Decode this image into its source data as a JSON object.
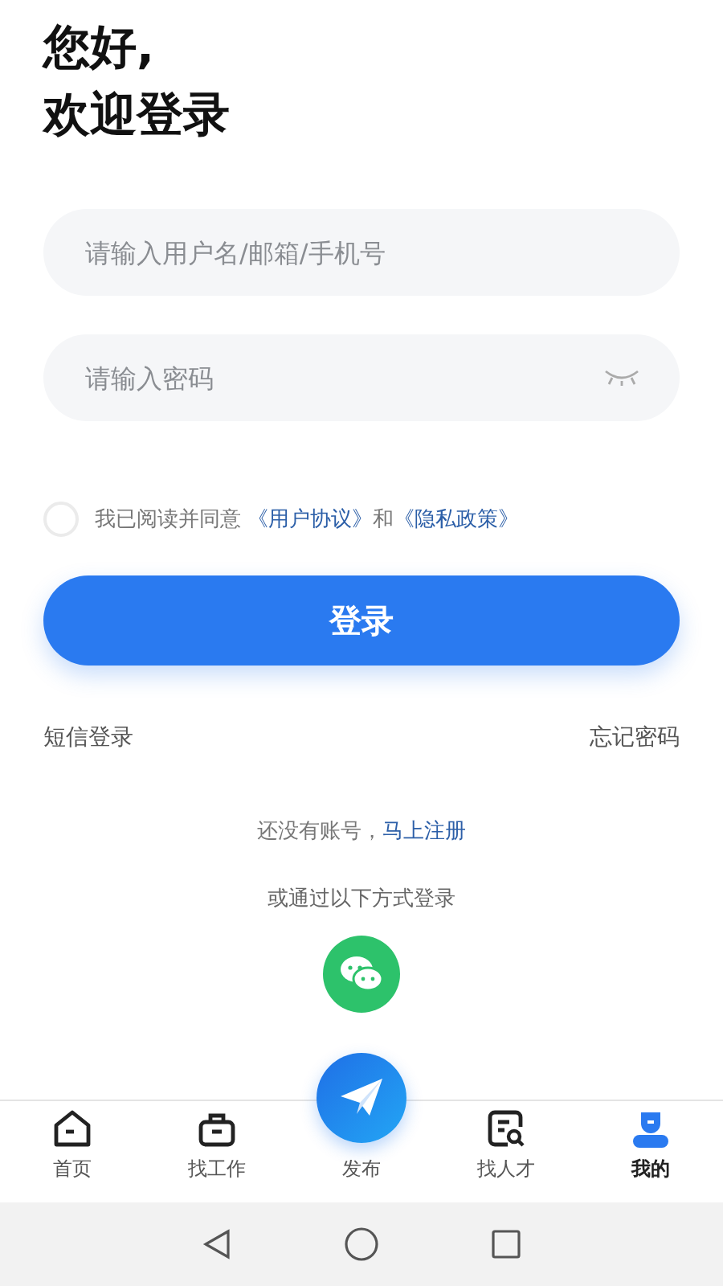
{
  "greeting": [
    "您好,",
    "欢迎登录"
  ],
  "fields": [
    {
      "placeholder": "请输入用户名/邮箱/手机号",
      "kind": "text"
    },
    {
      "placeholder": "请输入密码",
      "kind": "password"
    }
  ],
  "agreement": {
    "checked": false,
    "text": "我已阅读并同意",
    "link_1": "《用户协议》",
    "joiner": "和",
    "link_2": "《隐私政策》"
  },
  "login_button": "登录",
  "links": {
    "sms_login": "短信登录",
    "forgot_password": "忘记密码"
  },
  "register": {
    "text": "还没有账号，",
    "link": "马上注册"
  },
  "other_login": "或通过以下方式登录",
  "tabs": [
    {
      "label": "首页",
      "kind": "home",
      "selected": false
    },
    {
      "label": "找工作",
      "kind": "jobs",
      "selected": false
    },
    {
      "label": "发布",
      "kind": "publish",
      "selected": false
    },
    {
      "label": "找人才",
      "kind": "talent",
      "selected": false
    },
    {
      "label": "我的",
      "kind": "profile",
      "selected": true
    }
  ]
}
